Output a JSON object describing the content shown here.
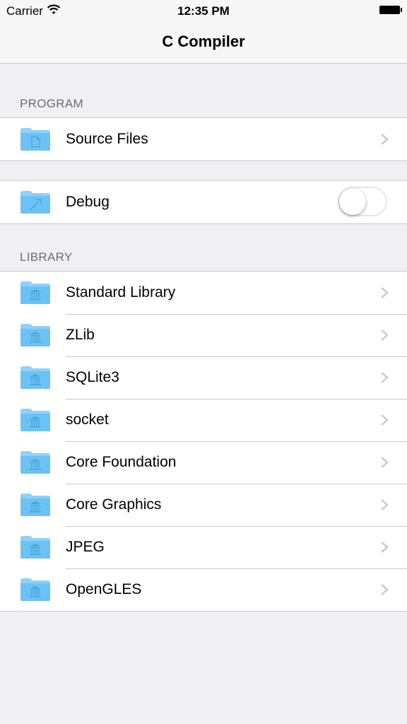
{
  "status_bar": {
    "carrier": "Carrier",
    "time": "12:35 PM"
  },
  "nav": {
    "title": "C Compiler"
  },
  "program": {
    "header": "PROGRAM",
    "source_files_label": "Source Files",
    "debug_label": "Debug",
    "debug_enabled": false
  },
  "library": {
    "header": "LIBRARY",
    "items": [
      {
        "label": "Standard Library"
      },
      {
        "label": "ZLib"
      },
      {
        "label": "SQLite3"
      },
      {
        "label": "socket"
      },
      {
        "label": "Core Foundation"
      },
      {
        "label": "Core Graphics"
      },
      {
        "label": "JPEG"
      },
      {
        "label": "OpenGLES"
      }
    ]
  },
  "icons": {
    "folder": "folder-icon",
    "document_folder": "document-folder-icon",
    "tools_folder": "tools-folder-icon",
    "library_folder": "library-folder-icon",
    "chevron": "chevron-right-icon"
  },
  "colors": {
    "accent": "#007aff",
    "folder": "#7ecbf7",
    "background": "#efeff4"
  }
}
